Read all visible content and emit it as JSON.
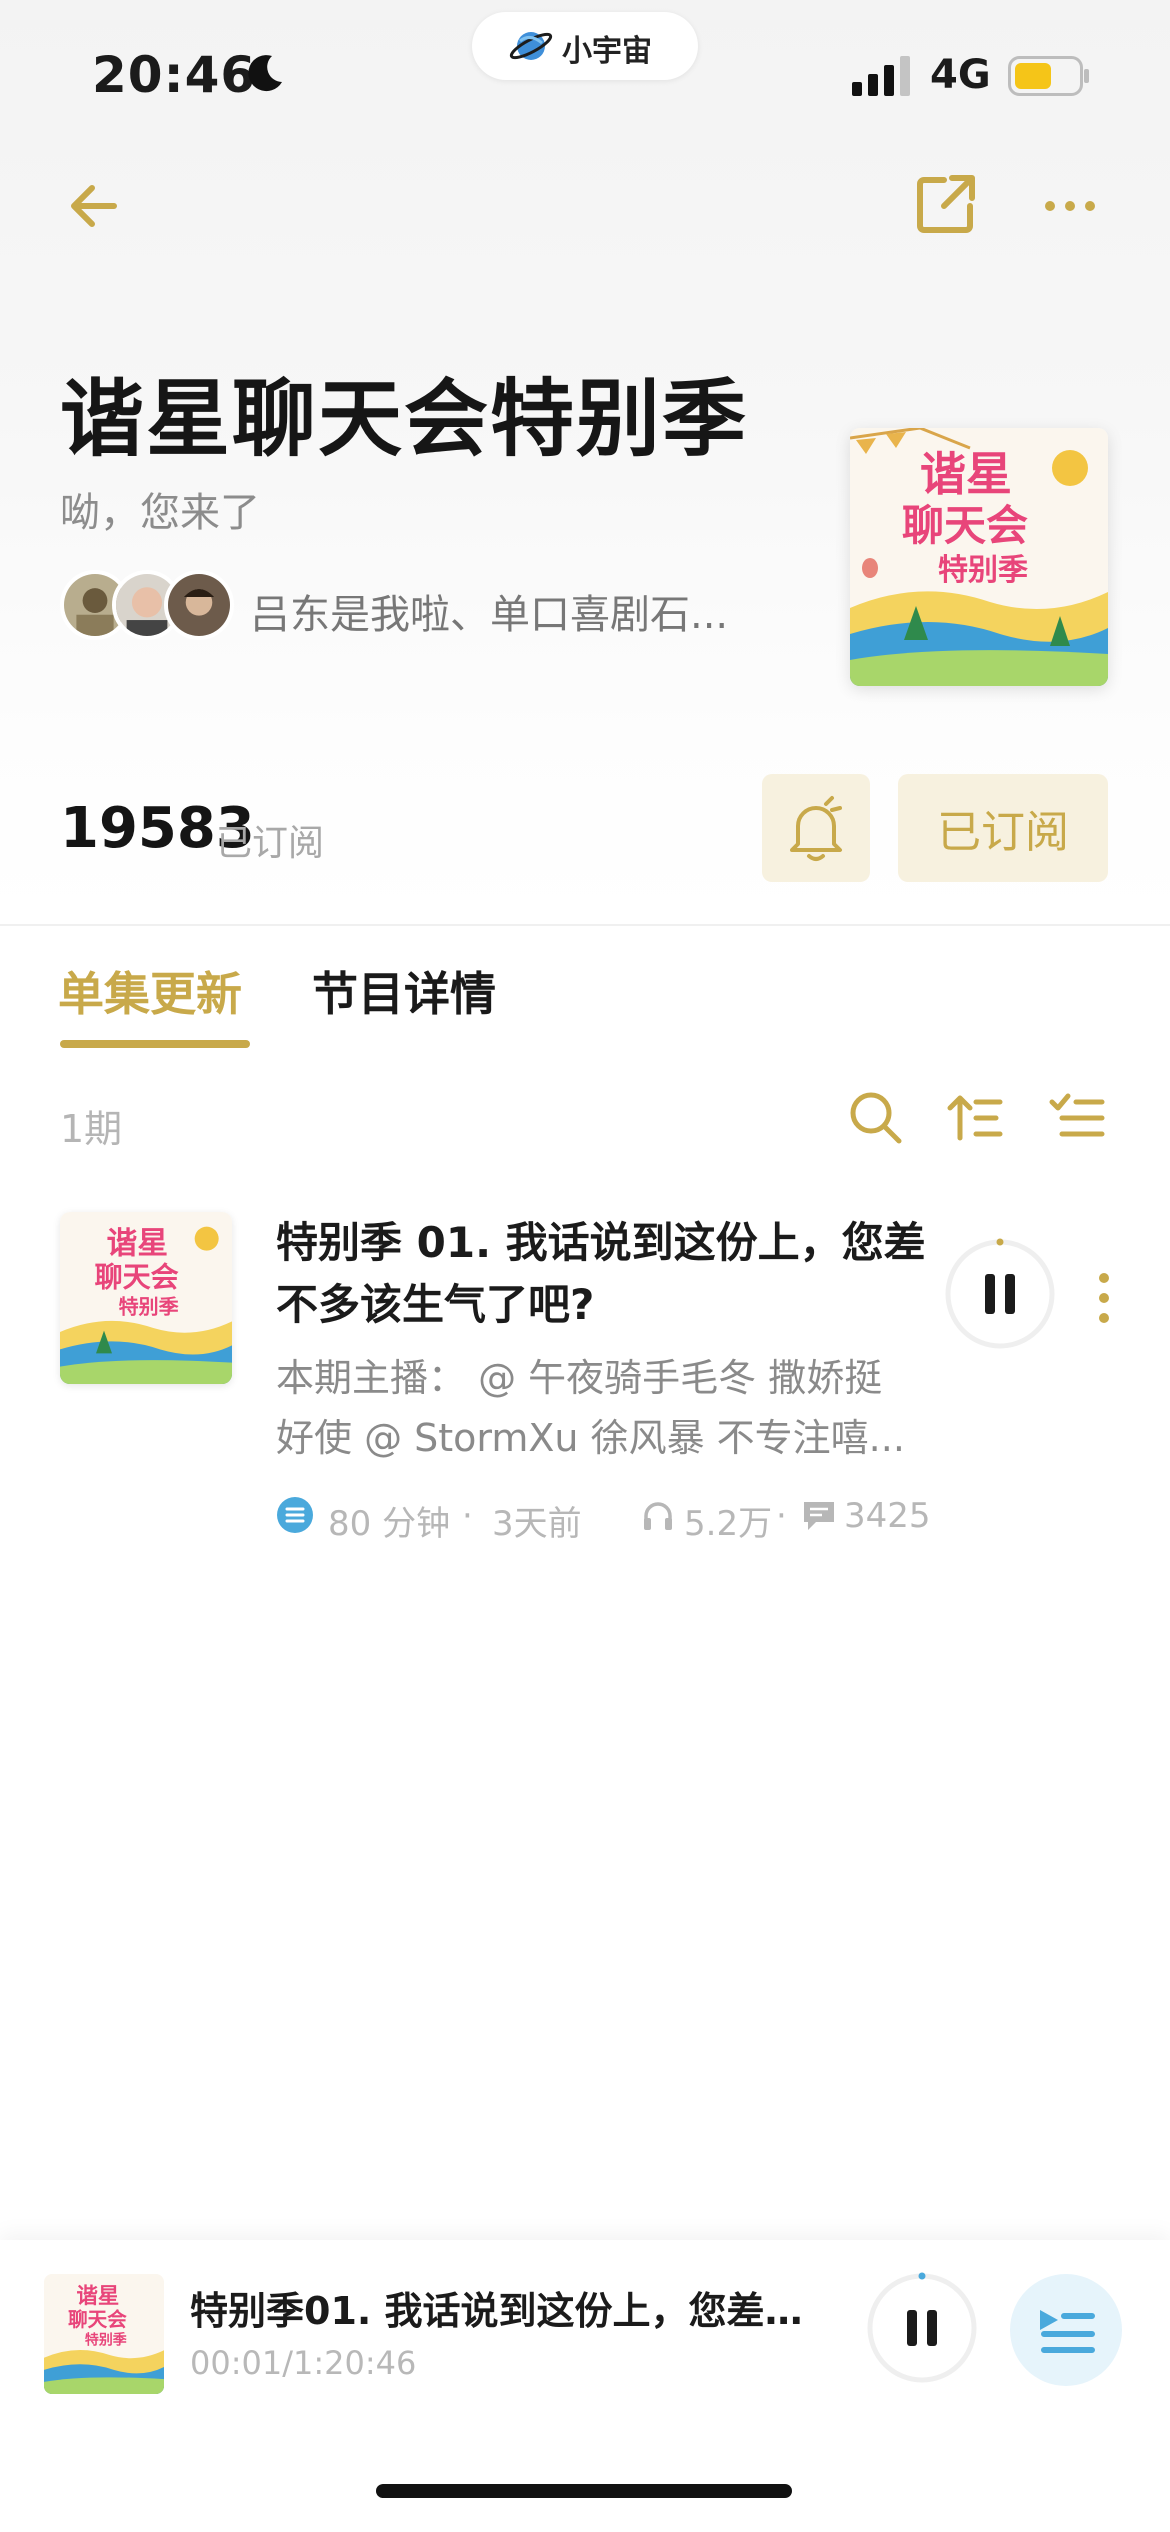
{
  "status_bar": {
    "time": "20:46",
    "network": "4G"
  },
  "island": {
    "label": "小宇宙"
  },
  "header": {
    "back_icon": "arrow-left-icon",
    "share_icon": "share-out-icon",
    "more_icon": "more-dots-icon"
  },
  "podcast": {
    "title": "谐星聊天会特别季",
    "subtitle": "呦，您来了",
    "hosts_text": "吕东是我啦、单口喜剧石...",
    "cover_lines": [
      "谐星",
      "聊天会",
      "特别季"
    ],
    "subscriber_count": "19583",
    "subscriber_label": "已订阅",
    "subscribe_button": "已订阅"
  },
  "tabs": [
    {
      "label": "单集更新",
      "active": true
    },
    {
      "label": "节目详情",
      "active": false
    }
  ],
  "episode_list": {
    "count_label": "1期",
    "episodes": [
      {
        "title": "特别季 01. 我话说到这份上，您差不多该生气了吧?",
        "description": "本期主播： @ 午夜骑手毛冬 撒娇挺好使 @ StormXu 徐风暴 不专注嘻...",
        "duration": "80 分钟",
        "published": "3天前",
        "plays": "5.2万",
        "comments": "3425"
      }
    ]
  },
  "mini_player": {
    "title": "特别季01. 我话说到这份上，您差不多...",
    "time": "00:01/1:20:46"
  },
  "colors": {
    "accent_gold": "#c8a94a",
    "accent_bg": "#f7f1df",
    "accent_blue": "#4aa9dc",
    "cover_pink": "#e8457a"
  }
}
